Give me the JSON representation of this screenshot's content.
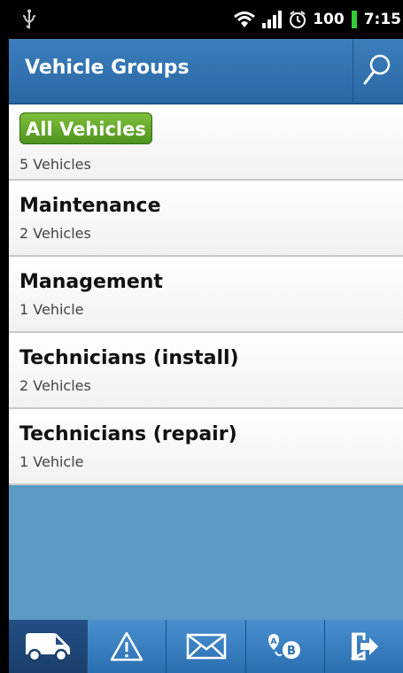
{
  "status_bar": {
    "battery": "100",
    "time": "7:15"
  },
  "header": {
    "title": "Vehicle Groups"
  },
  "groups": [
    {
      "name": "All Vehicles",
      "count": "5 Vehicles"
    },
    {
      "name": "Maintenance",
      "count": "2 Vehicles"
    },
    {
      "name": "Management",
      "count": "1 Vehicle"
    },
    {
      "name": "Technicians (install)",
      "count": "2 Vehicles"
    },
    {
      "name": "Technicians (repair)",
      "count": "1 Vehicle"
    }
  ],
  "tabs": [
    {
      "icon": "van-icon",
      "selected": true
    },
    {
      "icon": "warning-icon",
      "selected": false
    },
    {
      "icon": "mail-icon",
      "selected": false
    },
    {
      "icon": "route-ab-icon",
      "selected": false
    },
    {
      "icon": "logout-icon",
      "selected": false
    }
  ],
  "colors": {
    "accent": "#2a67a5",
    "badge": "#5ea52a",
    "background": "#5b9ac2"
  }
}
